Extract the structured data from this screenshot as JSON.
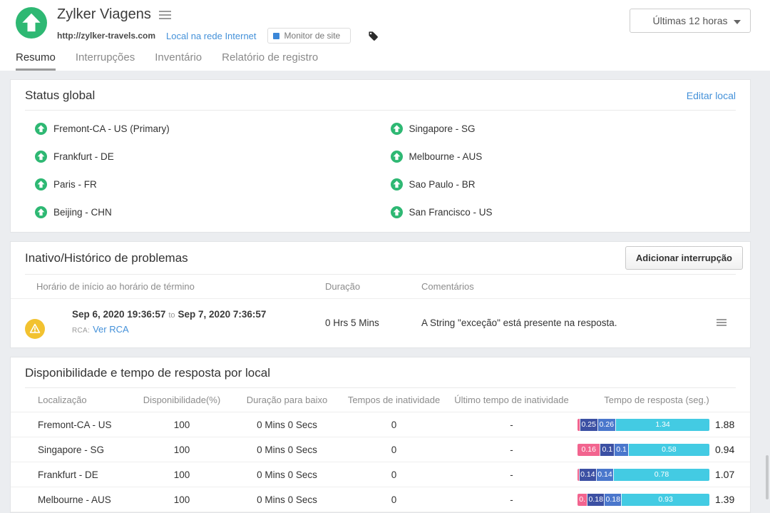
{
  "colors": {
    "up_green": "#2eb873",
    "link_blue": "#4491d9",
    "warning_yellow": "#f2c230",
    "badge_blue": "#3b87d8"
  },
  "header": {
    "title": "Zylker Viagens",
    "url": "http://zylker-travels.com",
    "link": "Local na rede Internet",
    "badge": "Monitor de site",
    "time_range": "Últimas 12 horas"
  },
  "tabs": [
    {
      "label": "Resumo",
      "active": true
    },
    {
      "label": "Interrupções",
      "active": false
    },
    {
      "label": "Inventário",
      "active": false
    },
    {
      "label": "Relatório de registro",
      "active": false
    }
  ],
  "status_global": {
    "title": "Status global",
    "edit_link": "Editar local",
    "locations": [
      {
        "name": "Fremont-CA - US (Primary)",
        "status": "up"
      },
      {
        "name": "Singapore - SG",
        "status": "up"
      },
      {
        "name": "Frankfurt - DE",
        "status": "up"
      },
      {
        "name": "Melbourne - AUS",
        "status": "up"
      },
      {
        "name": "Paris - FR",
        "status": "up"
      },
      {
        "name": "Sao Paulo - BR",
        "status": "up"
      },
      {
        "name": "Beijing - CHN",
        "status": "up"
      },
      {
        "name": "San Francisco - US",
        "status": "up"
      }
    ]
  },
  "outage_history": {
    "title": "Inativo/Histórico de problemas",
    "add_button": "Adicionar interrupção",
    "columns": [
      "Horário de início ao horário de término",
      "Duração",
      "Comentários"
    ],
    "row": {
      "start": "Sep 6, 2020 19:36:57",
      "to_label": "to",
      "end": "Sep 7, 2020 7:36:57",
      "rca_label": "RCA:",
      "rca_link": "Ver RCA",
      "duration": "0 Hrs 5 Mins",
      "comment": "A String \"exceção\" está presente na resposta."
    }
  },
  "availability": {
    "title": "Disponibilidade e tempo de resposta por local",
    "columns": [
      "Localização",
      "Disponibilidade(%)",
      "Duração para baixo",
      "Tempos de inatividade",
      "Último tempo de inatividade",
      "Tempo de resposta (seg.)"
    ],
    "bar_colors": [
      "#f2648f",
      "#3c50a3",
      "#4a77cc",
      "#43cbe3"
    ],
    "rows": [
      {
        "location": "Fremont-CA - US",
        "availability": "100",
        "downtime_duration": "0 Mins 0 Secs",
        "downtime_count": "0",
        "last_downtime": "-",
        "total": "1.88",
        "segments": [
          {
            "value": 0.03,
            "label": ""
          },
          {
            "value": 0.25,
            "label": "0.25"
          },
          {
            "value": 0.26,
            "label": "0.26"
          },
          {
            "value": 1.34,
            "label": "1.34"
          }
        ]
      },
      {
        "location": "Singapore - SG",
        "availability": "100",
        "downtime_duration": "0 Mins 0 Secs",
        "downtime_count": "0",
        "last_downtime": "-",
        "total": "0.94",
        "segments": [
          {
            "value": 0.16,
            "label": "0.16"
          },
          {
            "value": 0.1,
            "label": "0.1"
          },
          {
            "value": 0.1,
            "label": "0.1"
          },
          {
            "value": 0.58,
            "label": "0.58"
          }
        ]
      },
      {
        "location": "Frankfurt - DE",
        "availability": "100",
        "downtime_duration": "0 Mins 0 Secs",
        "downtime_count": "0",
        "last_downtime": "-",
        "total": "1.07",
        "segments": [
          {
            "value": 0.01,
            "label": ""
          },
          {
            "value": 0.14,
            "label": "0.14"
          },
          {
            "value": 0.14,
            "label": "0.14"
          },
          {
            "value": 0.78,
            "label": "0.78"
          }
        ]
      },
      {
        "location": "Melbourne - AUS",
        "availability": "100",
        "downtime_duration": "0 Mins 0 Secs",
        "downtime_count": "0",
        "last_downtime": "-",
        "total": "1.39",
        "segments": [
          {
            "value": 0.1,
            "label": "0."
          },
          {
            "value": 0.18,
            "label": "0.18"
          },
          {
            "value": 0.18,
            "label": "0.18"
          },
          {
            "value": 0.93,
            "label": "0.93"
          }
        ]
      }
    ]
  }
}
